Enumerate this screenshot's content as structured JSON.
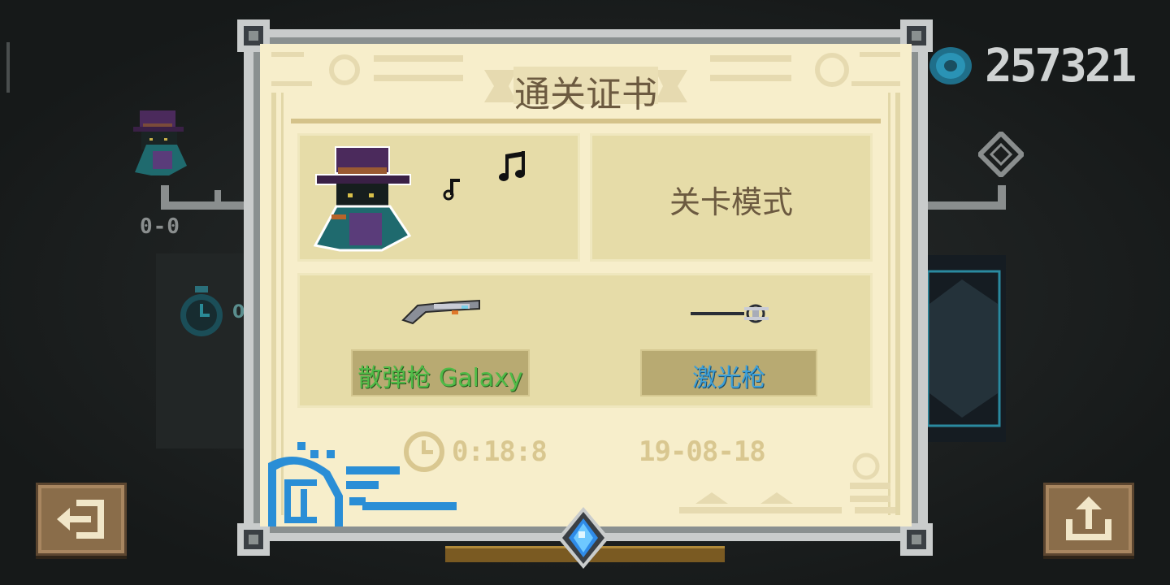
{
  "background": {
    "currency_value": "257321",
    "score": "0-0",
    "timer_partial": "0",
    "colors": {
      "gem": "#2a93b5",
      "text_light": "#cfd2d2",
      "text_dim": "#8a8e8e"
    }
  },
  "certificate": {
    "title": "通关证书",
    "mode": "关卡模式",
    "weapons": [
      {
        "name": "散弹枪 Galaxy",
        "color": "#4fbb47",
        "icon": "shotgun-icon"
      },
      {
        "name": "激光枪",
        "color": "#3ea0d8",
        "icon": "laser-gun-icon"
      }
    ],
    "time": "0:18:8",
    "date": "19-08-18",
    "colors": {
      "paper": "#f7eecb",
      "panel": "#e6dca8",
      "text": "#6c5a40",
      "faded": "#d9c790"
    }
  },
  "buttons": {
    "exit_icon": "exit-icon",
    "share_icon": "share-icon"
  }
}
